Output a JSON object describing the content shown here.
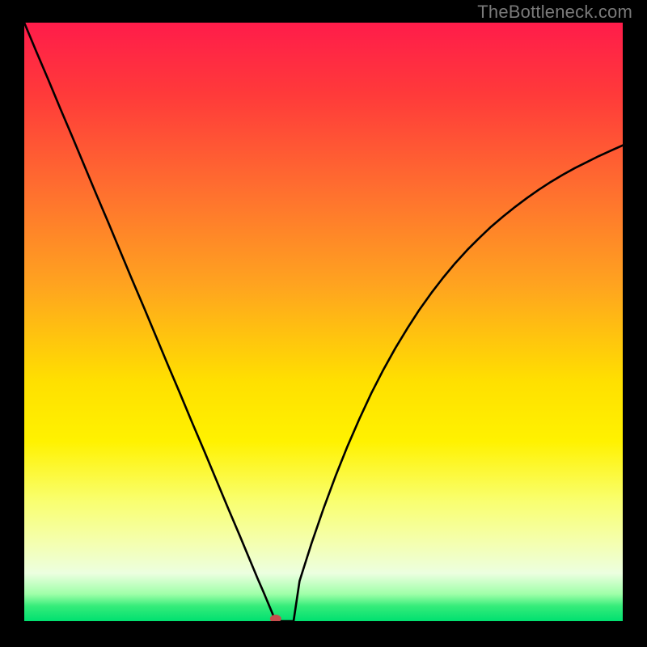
{
  "watermark": "TheBottleneck.com",
  "chart_data": {
    "type": "line",
    "title": "",
    "xlabel": "",
    "ylabel": "",
    "xlim": [
      0,
      100
    ],
    "ylim": [
      0,
      100
    ],
    "grid": false,
    "legend": false,
    "marker": {
      "x": 42,
      "y": 0
    },
    "background_gradient": {
      "stops": [
        {
          "t": 0.0,
          "color": "#ff1c4a"
        },
        {
          "t": 0.12,
          "color": "#ff3a3a"
        },
        {
          "t": 0.28,
          "color": "#ff6f2f"
        },
        {
          "t": 0.44,
          "color": "#ffa41f"
        },
        {
          "t": 0.6,
          "color": "#ffe000"
        },
        {
          "t": 0.7,
          "color": "#fff200"
        },
        {
          "t": 0.8,
          "color": "#f9ff70"
        },
        {
          "t": 0.87,
          "color": "#f4ffb0"
        },
        {
          "t": 0.92,
          "color": "#ecffe0"
        },
        {
          "t": 0.955,
          "color": "#9effa8"
        },
        {
          "t": 0.975,
          "color": "#35ec7a"
        },
        {
          "t": 1.0,
          "color": "#00e070"
        }
      ]
    },
    "series": [
      {
        "name": "curve",
        "x": [
          0,
          2,
          4,
          6,
          8,
          10,
          12,
          14,
          16,
          18,
          20,
          22,
          24,
          26,
          28,
          30,
          32,
          34,
          36,
          38,
          39,
          40,
          41,
          42,
          43,
          44,
          45,
          46,
          48,
          50,
          52,
          54,
          56,
          58,
          60,
          62,
          64,
          66,
          68,
          70,
          72,
          74,
          76,
          78,
          80,
          82,
          84,
          86,
          88,
          90,
          92,
          94,
          96,
          98,
          100
        ],
        "y": [
          100,
          95.2,
          90.5,
          85.7,
          81.0,
          76.2,
          71.4,
          66.7,
          61.9,
          57.1,
          52.4,
          47.6,
          42.8,
          38.1,
          33.3,
          28.6,
          23.8,
          19.0,
          14.3,
          9.5,
          7.1,
          4.8,
          2.4,
          0.0,
          0.0,
          0.0,
          0.0,
          6.7,
          13.0,
          18.8,
          24.2,
          29.2,
          33.8,
          38.1,
          42.0,
          45.6,
          48.9,
          52.0,
          54.8,
          57.4,
          59.8,
          62.0,
          64.0,
          65.9,
          67.6,
          69.2,
          70.7,
          72.1,
          73.4,
          74.6,
          75.7,
          76.7,
          77.7,
          78.6,
          79.5
        ]
      }
    ]
  }
}
